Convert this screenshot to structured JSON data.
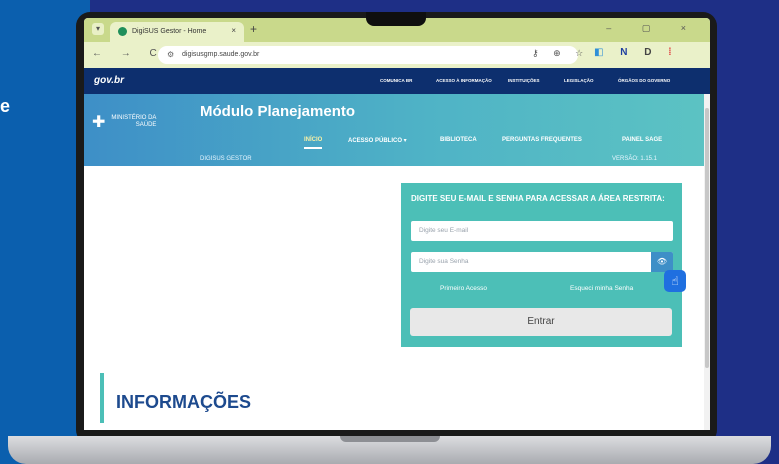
{
  "slide": {
    "stub_text": "e"
  },
  "browser": {
    "tab_title": "DigiSUS Gestor - Home",
    "tab_close": "×",
    "tab_new": "+",
    "window_controls": "– ▢ ×",
    "menu_icon": "▾",
    "nav_buttons": "← → C",
    "url": "digisusgmp.saude.gov.br",
    "toolbar_icons": "⚷ ⊕ ☆",
    "extensions": [
      "◧",
      "N",
      "D",
      "⁞"
    ]
  },
  "govbar": {
    "logo": "gov.br",
    "links": [
      "COMUNICA BR",
      "ACESSO À INFORMAÇÃO",
      "INSTITUIÇÕES",
      "LEGISLAÇÃO",
      "ÓRGÃOS DO GOVERNO"
    ]
  },
  "header": {
    "ministerio_line1": "MINISTÉRIO DA",
    "ministerio_line2": "SAÚDE",
    "cross": "✚",
    "title": "Módulo Planejamento",
    "nav": [
      "INÍCIO",
      "ACESSO PÚBLICO ▾",
      "BIBLIOTECA",
      "PERGUNTAS FREQUENTES",
      "PAINEL SAGE"
    ],
    "subtitle": "DIGISUS GESTOR",
    "version": "VERSÃO: 1.15.1"
  },
  "login": {
    "heading": "DIGITE SEU E-MAIL E SENHA PARA ACESSAR A ÁREA RESTRITA:",
    "email_placeholder": "Digite seu E-mail",
    "password_placeholder": "Digite sua Senha",
    "eye": "👁",
    "first_access": "Primeiro Acesso",
    "forgot_password": "Esqueci minha Senha",
    "enter": "Entrar"
  },
  "accessibility_icon": "☝",
  "info": {
    "title": "INFORMAÇÕES"
  },
  "colors": {
    "accent": "#4cbfb7",
    "gov_blue": "#0d2f6e",
    "title_blue": "#1d4a8e"
  }
}
